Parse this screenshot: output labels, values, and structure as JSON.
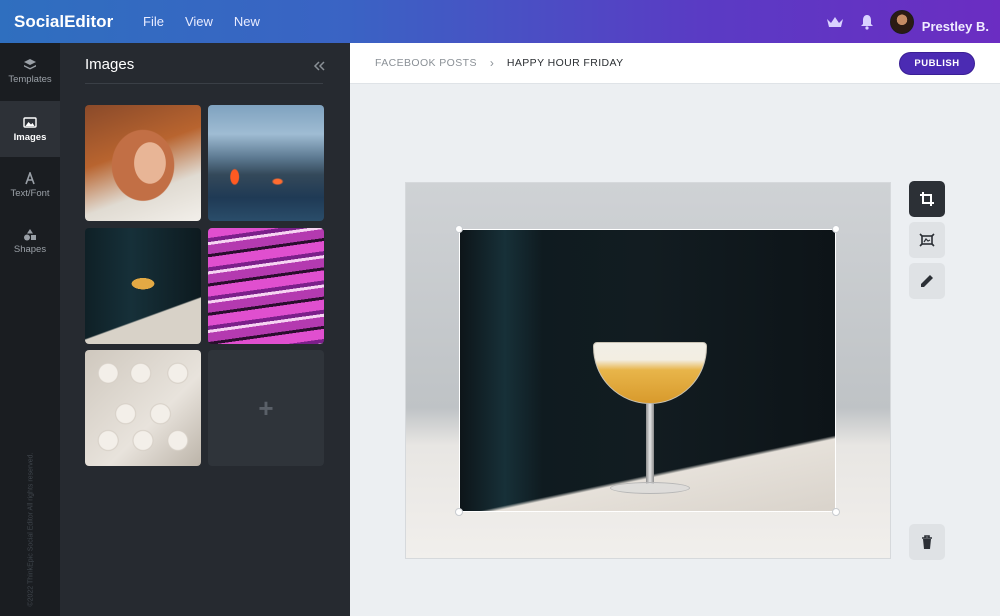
{
  "app": {
    "name": "SocialEditor"
  },
  "menu": {
    "items": [
      "File",
      "View",
      "New"
    ]
  },
  "user": {
    "name": "Prestley B."
  },
  "rail": {
    "items": [
      {
        "label": "Templates",
        "icon": "layers-icon"
      },
      {
        "label": "Images",
        "icon": "image-icon",
        "active": true
      },
      {
        "label": "Text/Font",
        "icon": "text-icon"
      },
      {
        "label": "Shapes",
        "icon": "shapes-icon"
      }
    ],
    "copyright": "©2022 ThinkEpic Social Editor All rights reserved."
  },
  "panel": {
    "title": "Images",
    "collapse_label": "«",
    "add_label": "+"
  },
  "breadcrumb": {
    "parent": "FACEBOOK POSTS",
    "separator": "›",
    "current": "HAPPY HOUR FRIDAY"
  },
  "publish_label": "PUBLISH",
  "tools": [
    "crop-icon",
    "image-frame-icon",
    "pencil-icon",
    "trash-icon"
  ],
  "colors": {
    "accent": "#4b2bb3",
    "rail_bg": "#1a1d21",
    "panel_bg": "#262a30"
  }
}
